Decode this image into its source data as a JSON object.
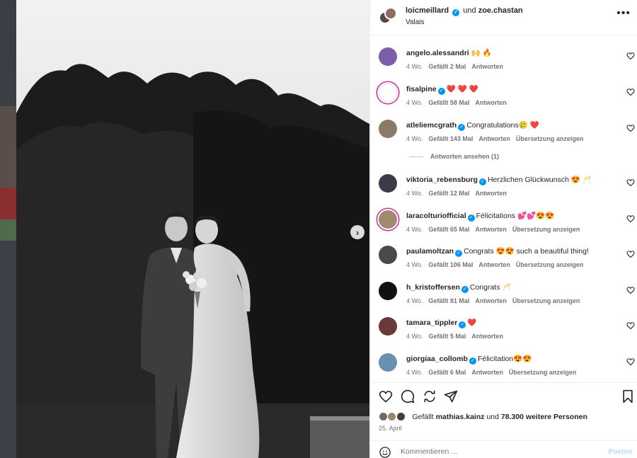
{
  "post": {
    "author": "loicmeillard",
    "conjunction": "und",
    "coauthor": "zoe.chastan",
    "location": "Valais",
    "more_label": "•••"
  },
  "comments": [
    {
      "user": "angelo.alessandri",
      "verified": false,
      "text": "🙌 🔥",
      "time": "4 Wo.",
      "likes": "Gefällt 2 Mal",
      "reply": "Antworten",
      "translate": "",
      "avatar_color": "#7b5ea7"
    },
    {
      "user": "fisalpine",
      "verified": true,
      "text": "❤️ ❤️ ❤️",
      "time": "4 Wo.",
      "likes": "Gefällt 58 Mal",
      "reply": "Antworten",
      "translate": "",
      "avatar_color": "#ffffff"
    },
    {
      "user": "atleliemcgrath",
      "verified": true,
      "text": "Congratulations🥲 ❤️",
      "time": "4 Wo.",
      "likes": "Gefällt 143 Mal",
      "reply": "Antworten",
      "translate": "Übersetzung anzeigen",
      "avatar_color": "#8a7a6a"
    },
    {
      "user": "viktoria_rebensburg",
      "verified": true,
      "text": "Herzlichen Glückwunsch 😍 🥂",
      "time": "4 Wo.",
      "likes": "Gefällt 12 Mal",
      "reply": "Antworten",
      "translate": "",
      "avatar_color": "#3b3b4a"
    },
    {
      "user": "laracolturiofficial",
      "verified": true,
      "text": "Félicitations 💕💕😍😍",
      "time": "4 Wo.",
      "likes": "Gefällt 65 Mal",
      "reply": "Antworten",
      "translate": "Übersetzung anzeigen",
      "avatar_color": "#a08a70"
    },
    {
      "user": "paulamoltzan",
      "verified": true,
      "text": "Congrats 😍😍 such a beautiful thing!",
      "time": "4 Wo.",
      "likes": "Gefällt 106 Mal",
      "reply": "Antworten",
      "translate": "Übersetzung anzeigen",
      "avatar_color": "#4a4a4a"
    },
    {
      "user": "h_kristoffersen",
      "verified": true,
      "text": "Congrats 🥂",
      "time": "4 Wo.",
      "likes": "Gefällt 81 Mal",
      "reply": "Antworten",
      "translate": "Übersetzung anzeigen",
      "avatar_color": "#111111"
    },
    {
      "user": "tamara_tippler",
      "verified": true,
      "text": "❤️",
      "time": "4 Wo.",
      "likes": "Gefällt 5 Mal",
      "reply": "Antworten",
      "translate": "",
      "avatar_color": "#6a3a3a"
    },
    {
      "user": "giorgiaa_collomb",
      "verified": true,
      "text": "Félicitation😍😍",
      "time": "4 Wo.",
      "likes": "Gefällt 6 Mal",
      "reply": "Antworten",
      "translate": "Übersetzung anzeigen",
      "avatar_color": "#6b8fb0"
    }
  ],
  "view_replies": "Antworten ansehen (1)",
  "likes_summary": {
    "prefix": "Gefällt",
    "user": "mathias.kainz",
    "middle": "und",
    "others": "78.300 weitere Personen"
  },
  "date": "25. April",
  "composer": {
    "placeholder": "Kommentieren ...",
    "post_label": "Posten"
  },
  "colors": {
    "accent": "#0095f6",
    "post_disabled": "#b3dbff",
    "heart": "#ed4956"
  }
}
